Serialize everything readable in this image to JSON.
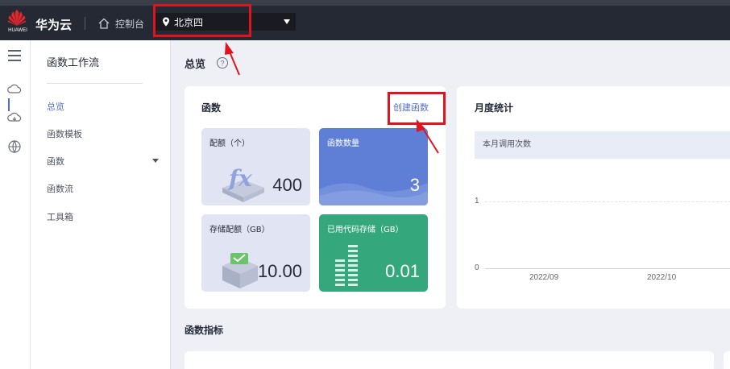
{
  "header": {
    "logo_text": "HUAWEI",
    "brand": "华为云",
    "console_label": "控制台",
    "region": "北京四"
  },
  "sidebar": {
    "title": "函数工作流",
    "items": [
      {
        "label": "总览",
        "active": true
      },
      {
        "label": "函数模板"
      },
      {
        "label": "函数",
        "expandable": true
      },
      {
        "label": "函数流"
      },
      {
        "label": "工具箱"
      }
    ]
  },
  "main": {
    "title": "总览",
    "functions_card": {
      "title": "函数",
      "create_link": "创建函数",
      "tiles": [
        {
          "label": "配额（个）",
          "value": "400"
        },
        {
          "label": "函数数量",
          "value": "3"
        },
        {
          "label": "存储配额（GB）",
          "value": "10.00"
        },
        {
          "label": "已用代码存储（GB）",
          "value": "0.01"
        }
      ]
    },
    "monthly_card": {
      "title": "月度统计",
      "legend": "本月调用次数",
      "y_ticks": [
        "1",
        "0"
      ],
      "x_ticks": [
        "2022/09",
        "2022/10"
      ]
    },
    "section2_title": "函数指标"
  },
  "colors": {
    "accent": "#526ecc",
    "topbar": "#252933",
    "tile_blue": "#5f7fd6",
    "tile_green": "#34a87c",
    "highlight": "#e0141e"
  }
}
